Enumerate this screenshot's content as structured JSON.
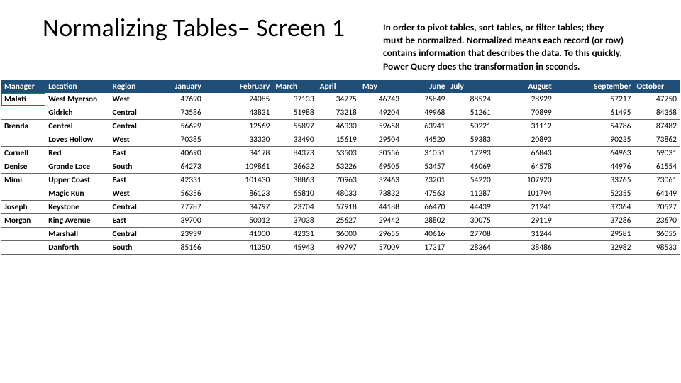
{
  "title": "Normalizing Tables– Screen 1",
  "description": "In order to pivot tables, sort tables, or filter tables; they must be normalized.  Normalized means each record (or row) contains information that describes the data. To this quickly, Power Query does the transformation in seconds.",
  "columns": [
    "Manager",
    "Location",
    "Region",
    "January",
    "February",
    "March",
    "April",
    "May",
    "June",
    "July",
    "August",
    "September",
    "October"
  ],
  "rows": [
    {
      "mgr": "Malati",
      "loc": "West Myerson",
      "reg": "West",
      "v": [
        47690,
        74085,
        37133,
        34775,
        46743,
        75849,
        88524,
        28929,
        57217,
        47750
      ]
    },
    {
      "mgr": "",
      "loc": "Gidrich",
      "reg": "Central",
      "v": [
        73586,
        43831,
        51988,
        73218,
        49204,
        49968,
        51261,
        70899,
        61495,
        84358
      ]
    },
    {
      "mgr": "Brenda",
      "loc": "Central",
      "reg": "Central",
      "v": [
        56629,
        12569,
        55897,
        46330,
        59658,
        63941,
        50221,
        31112,
        54786,
        87482
      ]
    },
    {
      "mgr": "",
      "loc": "Loves Hollow",
      "reg": "West",
      "v": [
        70385,
        33330,
        33490,
        15619,
        29504,
        44520,
        59383,
        20893,
        90235,
        73862
      ]
    },
    {
      "mgr": "Cornell",
      "loc": "Red",
      "reg": "East",
      "v": [
        40690,
        34178,
        84373,
        53503,
        30556,
        31051,
        17293,
        66843,
        64963,
        59031
      ]
    },
    {
      "mgr": "Denise",
      "loc": "Grande Lace",
      "reg": "South",
      "v": [
        64273,
        109861,
        36632,
        53226,
        69505,
        53457,
        46069,
        64578,
        44976,
        61554
      ]
    },
    {
      "mgr": "Mimi",
      "loc": "Upper Coast",
      "reg": "East",
      "v": [
        42331,
        101430,
        38863,
        70963,
        32463,
        73201,
        54220,
        107920,
        33765,
        73061
      ]
    },
    {
      "mgr": "",
      "loc": "Magic Run",
      "reg": "West",
      "v": [
        56356,
        86123,
        65810,
        48033,
        73832,
        47563,
        11287,
        101794,
        52355,
        64149
      ]
    },
    {
      "mgr": "Joseph",
      "loc": "Keystone",
      "reg": "Central",
      "v": [
        77787,
        34797,
        23704,
        57918,
        44188,
        66470,
        44439,
        21241,
        37364,
        70527
      ]
    },
    {
      "mgr": "Morgan",
      "loc": "King Avenue",
      "reg": "East",
      "v": [
        39700,
        50012,
        37038,
        25627,
        29442,
        28802,
        30075,
        29119,
        37286,
        23670
      ]
    },
    {
      "mgr": "",
      "loc": "Marshall",
      "reg": "Central",
      "v": [
        23939,
        41000,
        42331,
        36000,
        29655,
        40616,
        27708,
        31244,
        29581,
        36055
      ]
    },
    {
      "mgr": "",
      "loc": "Danforth",
      "reg": "South",
      "v": [
        85166,
        41350,
        45943,
        49797,
        57009,
        17317,
        28364,
        38486,
        32982,
        98533
      ]
    }
  ]
}
